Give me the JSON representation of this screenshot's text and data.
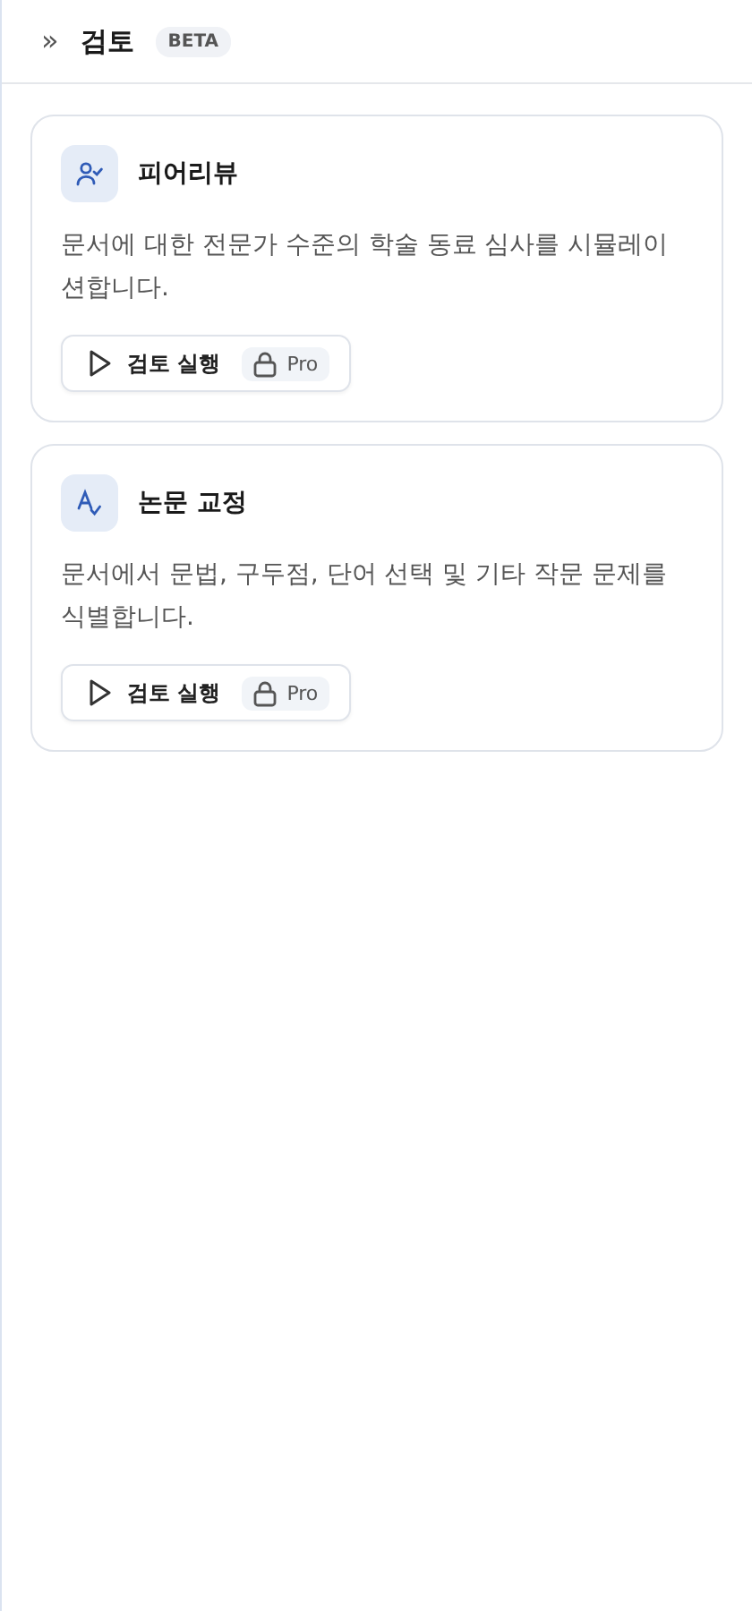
{
  "header": {
    "expand_icon": "»",
    "title": "검토",
    "badge": "BETA"
  },
  "tools": [
    {
      "kind": "peer_review",
      "title": "피어리뷰",
      "description": "문서에 대한 전문가 수준의 학술 동료 심사를 시뮬레이션합니다.",
      "button": "검토 실행",
      "lock_badge": "Pro"
    },
    {
      "kind": "proofread",
      "title": "논문 교정",
      "description": "문서에서 문법, 구두점, 단어 선택 및 기타 작문 문제를 식별합니다.",
      "button": "검토 실행",
      "lock_badge": "Pro"
    }
  ]
}
